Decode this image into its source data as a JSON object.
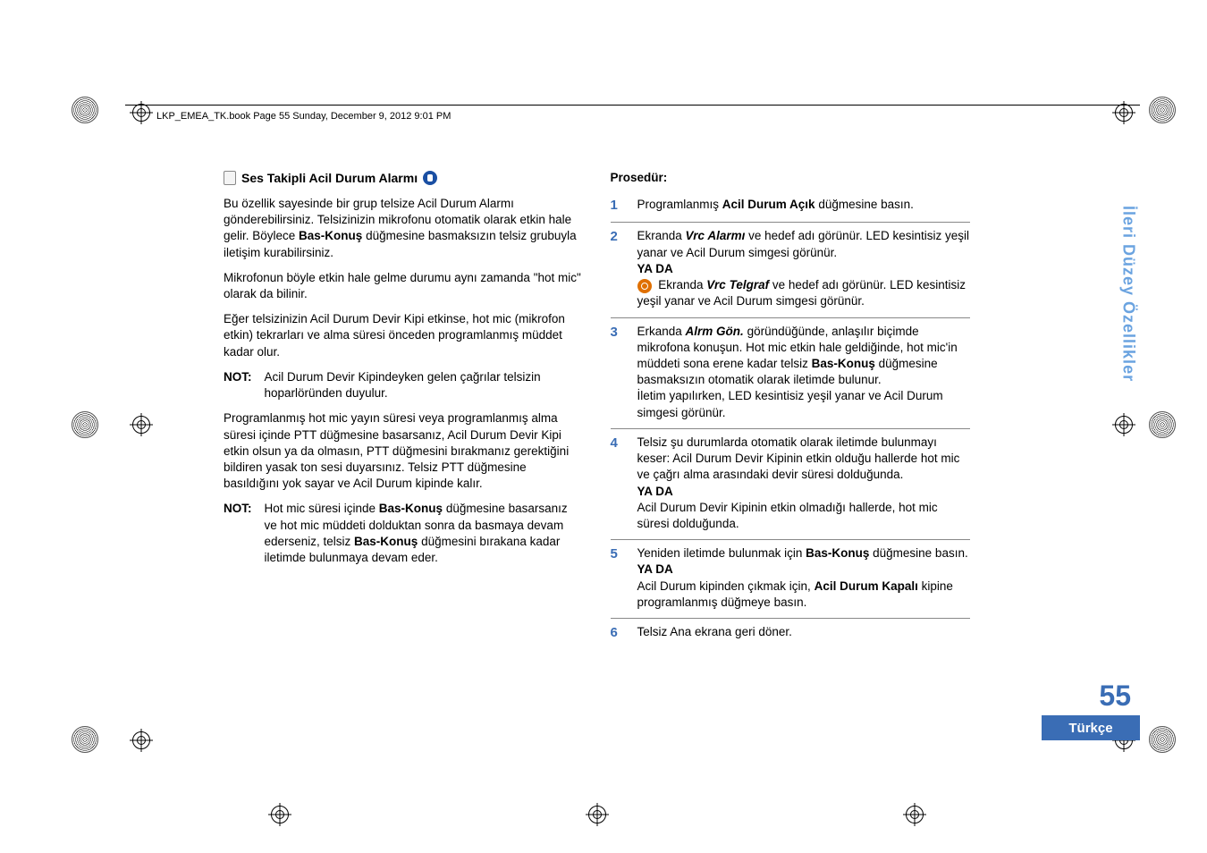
{
  "header": "LKP_EMEA_TK.book  Page 55  Sunday, December 9, 2012  9:01 PM",
  "left": {
    "heading": "Ses Takipli Acil Durum Alarmı",
    "p1a": "Bu özellik sayesinde bir grup telsize Acil Durum Alarmı gönderebilirsiniz. Telsizinizin mikrofonu otomatik olarak etkin hale gelir. Böylece ",
    "p1b_bold": "Bas-Konuş",
    "p1c": " düğmesine basmaksızın telsiz grubuyla iletişim kurabilirsiniz.",
    "p2": "Mikrofonun böyle etkin hale gelme durumu aynı zamanda \"hot mic\" olarak da bilinir.",
    "p3": "Eğer telsizinizin Acil Durum Devir Kipi etkinse, hot mic (mikrofon etkin) tekrarları ve alma süresi önceden programlanmış müddet kadar olur.",
    "note1_label": "NOT:",
    "note1_body": "Acil Durum Devir Kipindeyken gelen çağrılar telsizin hoparlöründen duyulur.",
    "p4": "Programlanmış hot mic yayın süresi veya programlanmış alma süresi içinde PTT düğmesine basarsanız, Acil Durum Devir Kipi etkin olsun ya da olmasın, PTT düğmesini bırakmanız gerektiğini bildiren yasak ton sesi duyarsınız. Telsiz PTT düğmesine basıldığını yok sayar ve Acil Durum kipinde kalır.",
    "note2_label": "NOT:",
    "note2a": "Hot mic süresi içinde ",
    "note2b_bold": "Bas-Konuş",
    "note2c": " düğmesine basarsanız ve hot mic müddeti dolduktan sonra da basmaya devam ederseniz, telsiz ",
    "note2d_bold": "Bas-Konuş",
    "note2e": " düğmesini bırakana kadar iletimde bulunmaya devam eder."
  },
  "right": {
    "proc_title": "Prosedür:",
    "steps": {
      "s1": {
        "num": "1",
        "a": "Programlanmış ",
        "b_bold": "Acil Durum Açık",
        "c": " düğmesine basın."
      },
      "s2": {
        "num": "2",
        "a": "Ekranda ",
        "b_bi": "Vrc Alarmı",
        "c": " ve hedef adı görünür. LED kesintisiz yeşil yanar ve Acil Durum simgesi görünür.",
        "yada": "YA DA",
        "d": " Ekranda ",
        "e_bi": "Vrc Telgraf",
        "f": " ve hedef adı görünür. LED kesintisiz yeşil yanar ve Acil Durum simgesi görünür."
      },
      "s3": {
        "num": "3",
        "a": "Erkanda ",
        "b_bi": "Alrm Gön.",
        "c": " göründüğünde, anlaşılır biçimde mikrofona konuşun. Hot mic etkin hale geldiğinde, hot mic'in müddeti sona erene kadar telsiz ",
        "d_bold": "Bas-Konuş",
        "e": " düğmesine basmaksızın otomatik olarak iletimde bulunur.",
        "f": "İletim yapılırken, LED kesintisiz yeşil yanar ve Acil Durum simgesi görünür."
      },
      "s4": {
        "num": "4",
        "a": "Telsiz şu durumlarda otomatik olarak iletimde bulunmayı keser: Acil Durum Devir Kipinin etkin olduğu hallerde hot mic ve çağrı alma arasındaki devir süresi dolduğunda.",
        "yada": "YA DA",
        "b": "Acil Durum Devir Kipinin etkin olmadığı hallerde, hot mic süresi dolduğunda."
      },
      "s5": {
        "num": "5",
        "a": "Yeniden iletimde bulunmak için ",
        "b_bold": "Bas-Konuş",
        "c": " düğmesine basın.",
        "yada": "YA DA",
        "d": "Acil Durum kipinden çıkmak için, ",
        "e_bold": "Acil Durum Kapalı",
        "f": " kipine programlanmış düğmeye basın."
      },
      "s6": {
        "num": "6",
        "a": "Telsiz Ana ekrana geri döner."
      }
    }
  },
  "side_tab": "İleri Düzey Özellikler",
  "page_number": "55",
  "language": "Türkçe"
}
